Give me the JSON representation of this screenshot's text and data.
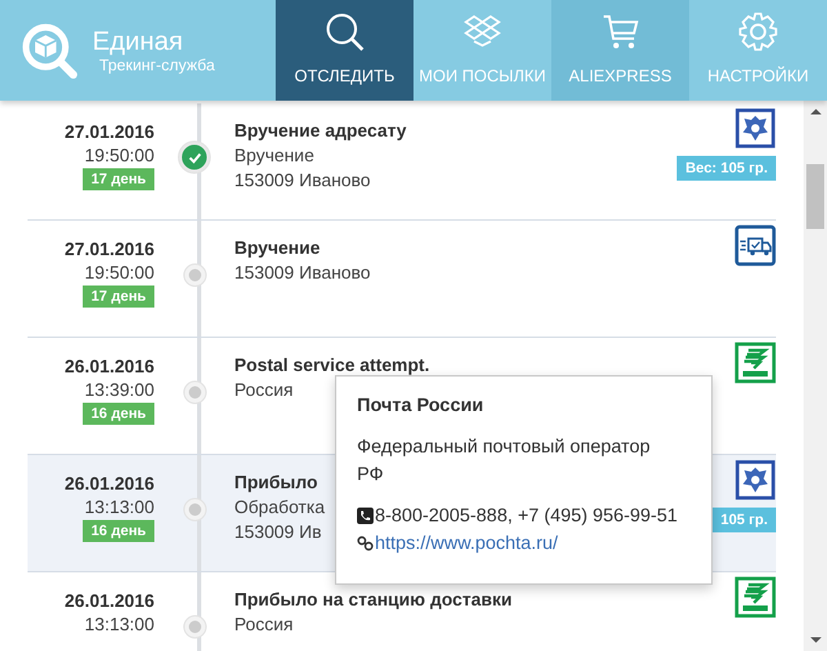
{
  "header": {
    "app_name": "Единая",
    "app_subtitle": "Трекинг-служба"
  },
  "tabs": [
    {
      "label": "ОТСЛЕДИТЬ",
      "kind": "search",
      "selected": true
    },
    {
      "label": "МОИ ПОСЫЛКИ",
      "kind": "box",
      "selected": false
    },
    {
      "label": "ALIEXPRESS",
      "kind": "cart",
      "selected": false
    },
    {
      "label": "НАСТРОЙКИ",
      "kind": "gear",
      "selected": false
    }
  ],
  "events": [
    {
      "date": "27.01.2016",
      "time": "19:50:00",
      "day": "17 день",
      "title": "Вручение адресату",
      "lines": [
        "Вручение",
        "153009 Иваново"
      ],
      "delivered": true,
      "highlighted": false,
      "kind": "eagle",
      "weight": "Вес: 105 гр."
    },
    {
      "date": "27.01.2016",
      "time": "19:50:00",
      "day": "17 день",
      "title": "Вручение",
      "lines": [
        "153009 Иваново"
      ],
      "delivered": false,
      "highlighted": false,
      "kind": "truck"
    },
    {
      "date": "26.01.2016",
      "time": "13:39:00",
      "day": "16 день",
      "title": "Postal service attempt.",
      "lines": [
        "Россия"
      ],
      "delivered": false,
      "highlighted": false,
      "kind": "emblem"
    },
    {
      "date": "26.01.2016",
      "time": "13:13:00",
      "day": "16 день",
      "title": "Прибыло",
      "lines": [
        "Обработка",
        "153009 Ив"
      ],
      "delivered": false,
      "highlighted": true,
      "kind": "eagle",
      "weight": "105 гр."
    },
    {
      "date": "26.01.2016",
      "time": "13:13:00",
      "title": "Прибыло на станцию доставки",
      "lines": [
        "Россия"
      ],
      "delivered": false,
      "highlighted": false,
      "kind": "emblem"
    }
  ],
  "popover": {
    "title": "Почта России",
    "description": "Федеральный почтовый оператор РФ",
    "phone": "8-800-2005-888, +7 (495) 956-99-51",
    "link": "https://www.pochta.ru/"
  }
}
